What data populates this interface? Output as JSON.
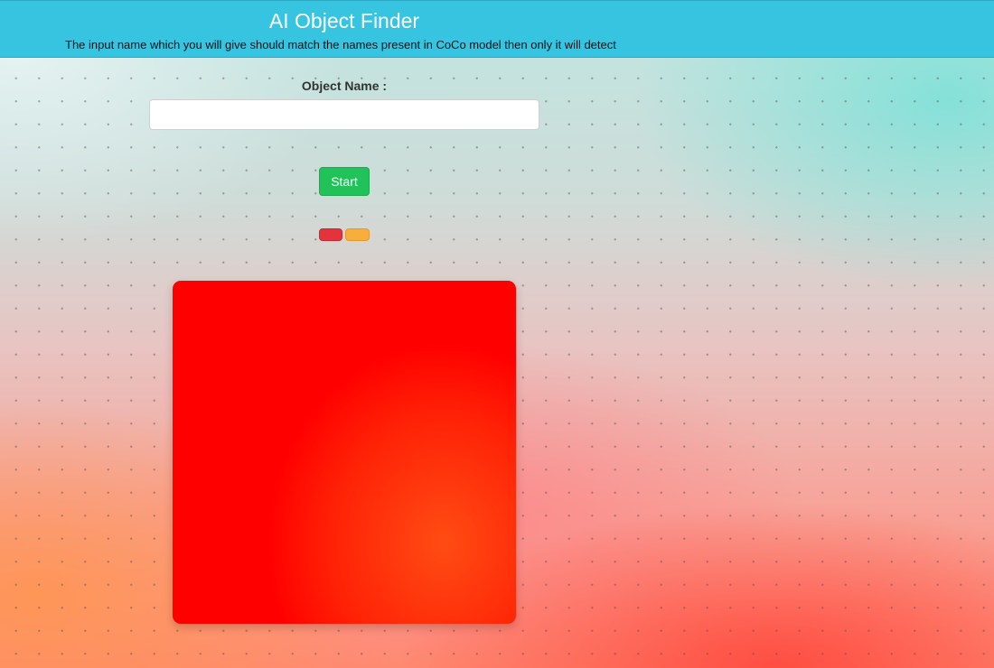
{
  "header": {
    "title": "AI Object Finder",
    "subtitle": "The input name which you will give should match the names present in CoCo model then only it will detect"
  },
  "form": {
    "label": "Object Name :",
    "input_value": "",
    "start_label": "Start"
  },
  "colors": {
    "navbar": "#36c4e1",
    "start_button": "#22c25a",
    "red_button": "#e3343e",
    "orange_button": "#f8ae3c",
    "canvas": "#ff0000"
  }
}
